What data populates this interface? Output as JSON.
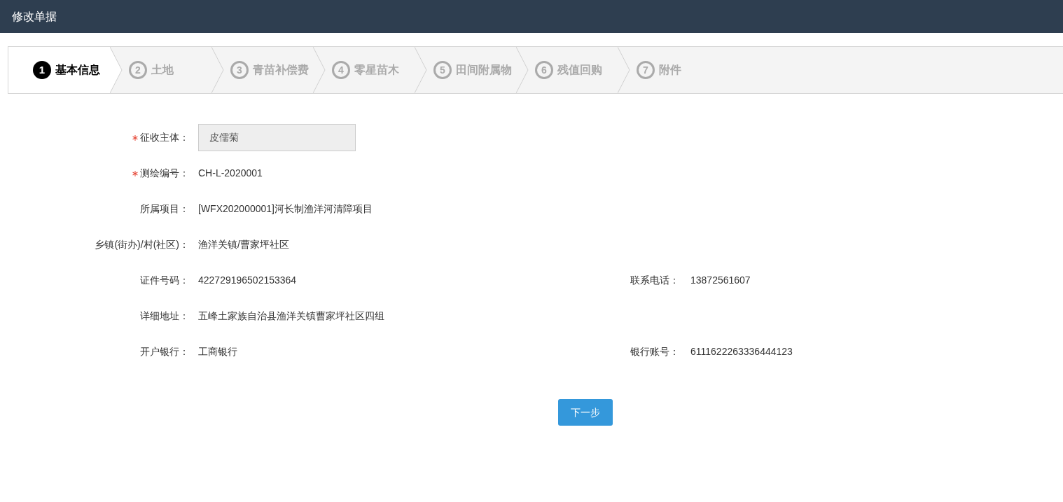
{
  "header": {
    "title": "修改单据"
  },
  "steps": [
    {
      "number": "1",
      "label": "基本信息",
      "selected": true
    },
    {
      "number": "2",
      "label": "土地",
      "selected": false
    },
    {
      "number": "3",
      "label": "青苗补偿费",
      "selected": false
    },
    {
      "number": "4",
      "label": "零星苗木",
      "selected": false
    },
    {
      "number": "5",
      "label": "田间附属物",
      "selected": false
    },
    {
      "number": "6",
      "label": "残值回购",
      "selected": false
    },
    {
      "number": "7",
      "label": "附件",
      "selected": false
    }
  ],
  "form_rows": [
    {
      "fields": [
        {
          "kind": "input",
          "label": "征收主体：",
          "required": true,
          "value": "皮儒菊"
        }
      ]
    },
    {
      "fields": [
        {
          "kind": "text",
          "label": "测绘编号：",
          "required": true,
          "value": "CH-L-2020001"
        }
      ]
    },
    {
      "fields": [
        {
          "kind": "text",
          "label": "所属项目：",
          "required": false,
          "value": "[WFX202000001]河长制渔洋河清障项目"
        }
      ]
    },
    {
      "fields": [
        {
          "kind": "text",
          "label": "乡镇(街办)/村(社区)：",
          "required": false,
          "value": "渔洋关镇/曹家坪社区"
        }
      ]
    },
    {
      "fields": [
        {
          "kind": "text",
          "label": "证件号码：",
          "required": false,
          "value": "422729196502153364"
        },
        {
          "kind": "text",
          "label": "联系电话：",
          "required": false,
          "value": "13872561607"
        }
      ]
    },
    {
      "fields": [
        {
          "kind": "text",
          "label": "详细地址：",
          "required": false,
          "value": "五峰土家族自治县渔洋关镇曹家坪社区四组"
        }
      ]
    },
    {
      "fields": [
        {
          "kind": "text",
          "label": "开户银行：",
          "required": false,
          "value": "工商银行"
        },
        {
          "kind": "text",
          "label": "银行账号：",
          "required": false,
          "value": "6111622263336444123"
        }
      ]
    }
  ],
  "next_button": "下一步"
}
